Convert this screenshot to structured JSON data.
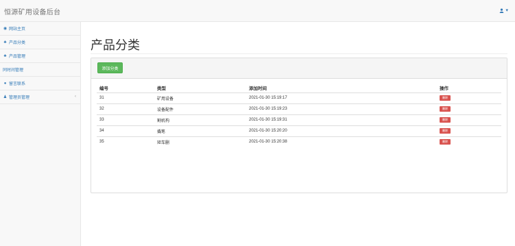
{
  "navbar": {
    "brand": "恒源矿用设备后台",
    "user_icon": "user-icon",
    "caret": "▾"
  },
  "sidebar": {
    "items": [
      {
        "icon": "dashboard-icon",
        "glyph": "◉",
        "label": "网站主页"
      },
      {
        "icon": "sitemap-icon",
        "glyph": "♣",
        "label": "产品分类"
      },
      {
        "icon": "cubes-icon",
        "glyph": "♣",
        "label": "产品管理"
      },
      {
        "icon": "",
        "glyph": "",
        "label": "同时间管理"
      },
      {
        "icon": "comments-icon",
        "glyph": "●",
        "label": "留言联系"
      },
      {
        "icon": "user-icon",
        "glyph": "♟",
        "label": "管理员管理",
        "caret": "‹"
      }
    ]
  },
  "main": {
    "title": "产品分类",
    "add_button": "添加分类",
    "table": {
      "headers": [
        "编号",
        "类型",
        "添加时间",
        "操作"
      ],
      "rows": [
        {
          "id": "31",
          "type": "矿用设备",
          "time": "2021-01-30 15:19:17",
          "action": "删除"
        },
        {
          "id": "32",
          "type": "设备配件",
          "time": "2021-01-30 15:19:23",
          "action": "删除"
        },
        {
          "id": "33",
          "type": "割机构",
          "time": "2021-01-30 15:19:31",
          "action": "删除"
        },
        {
          "id": "34",
          "type": "撬笔",
          "time": "2021-01-30 15:20:20",
          "action": "删除"
        },
        {
          "id": "35",
          "type": "矩车删",
          "time": "2021-01-30 15:20:38",
          "action": "删除"
        }
      ]
    }
  },
  "colors": {
    "accent": "#337ab7",
    "success": "#5cb85c",
    "danger": "#d9534f"
  }
}
